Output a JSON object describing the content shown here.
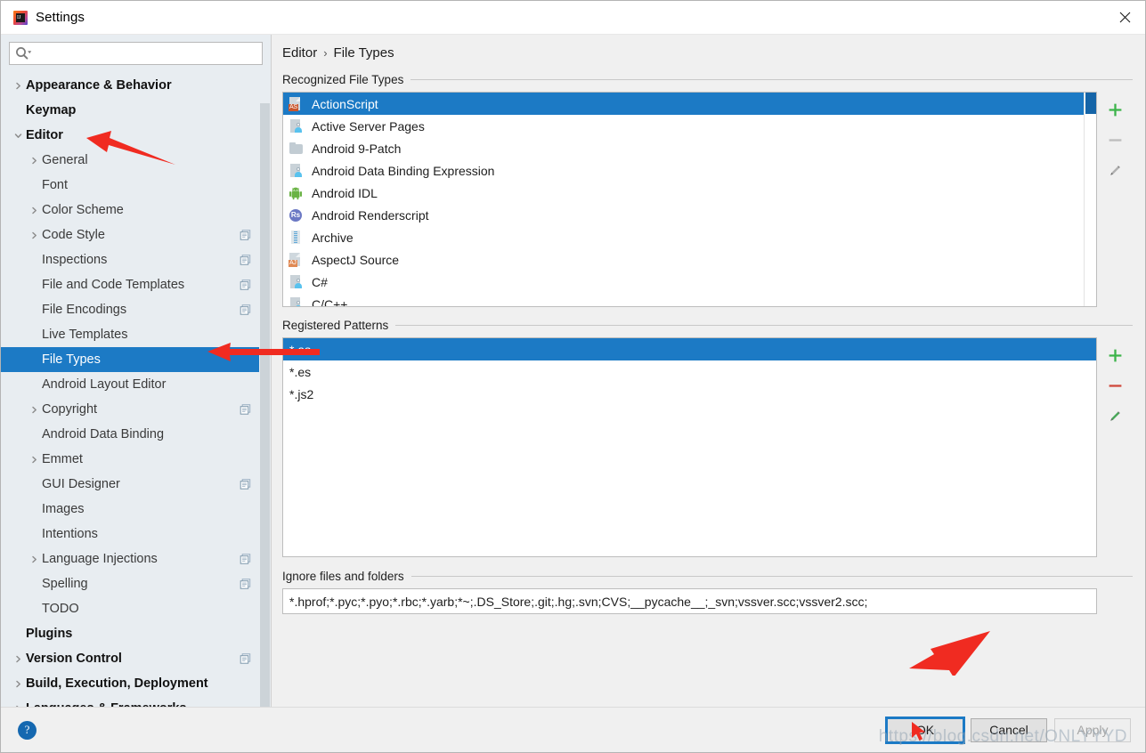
{
  "window": {
    "title": "Settings",
    "app_icon": "intellij-idea-icon",
    "close_label": "✕"
  },
  "search": {
    "value": "",
    "placeholder": "",
    "icon": "search-icon"
  },
  "sidebar": {
    "items": [
      {
        "label": "Appearance & Behavior",
        "level": 0,
        "style": "bold",
        "arrow": "chevron-right",
        "badge": false,
        "selected": false
      },
      {
        "label": "Keymap",
        "level": 0,
        "style": "bold",
        "arrow": "none",
        "badge": false,
        "selected": false
      },
      {
        "label": "Editor",
        "level": 0,
        "style": "bold",
        "arrow": "chevron-down",
        "badge": false,
        "selected": false
      },
      {
        "label": "General",
        "level": 1,
        "style": "sub",
        "arrow": "chevron-right",
        "badge": false,
        "selected": false
      },
      {
        "label": "Font",
        "level": 1,
        "style": "sub",
        "arrow": "none",
        "badge": false,
        "selected": false
      },
      {
        "label": "Color Scheme",
        "level": 1,
        "style": "sub",
        "arrow": "chevron-right",
        "badge": false,
        "selected": false
      },
      {
        "label": "Code Style",
        "level": 1,
        "style": "sub",
        "arrow": "chevron-right",
        "badge": true,
        "selected": false
      },
      {
        "label": "Inspections",
        "level": 1,
        "style": "sub",
        "arrow": "none",
        "badge": true,
        "selected": false
      },
      {
        "label": "File and Code Templates",
        "level": 1,
        "style": "sub",
        "arrow": "none",
        "badge": true,
        "selected": false
      },
      {
        "label": "File Encodings",
        "level": 1,
        "style": "sub",
        "arrow": "none",
        "badge": true,
        "selected": false
      },
      {
        "label": "Live Templates",
        "level": 1,
        "style": "sub",
        "arrow": "none",
        "badge": false,
        "selected": false
      },
      {
        "label": "File Types",
        "level": 1,
        "style": "sub",
        "arrow": "none",
        "badge": false,
        "selected": true
      },
      {
        "label": "Android Layout Editor",
        "level": 1,
        "style": "sub",
        "arrow": "none",
        "badge": false,
        "selected": false
      },
      {
        "label": "Copyright",
        "level": 1,
        "style": "sub",
        "arrow": "chevron-right",
        "badge": true,
        "selected": false
      },
      {
        "label": "Android Data Binding",
        "level": 1,
        "style": "sub",
        "arrow": "none",
        "badge": false,
        "selected": false
      },
      {
        "label": "Emmet",
        "level": 1,
        "style": "sub",
        "arrow": "chevron-right",
        "badge": false,
        "selected": false
      },
      {
        "label": "GUI Designer",
        "level": 1,
        "style": "sub",
        "arrow": "none",
        "badge": true,
        "selected": false
      },
      {
        "label": "Images",
        "level": 1,
        "style": "sub",
        "arrow": "none",
        "badge": false,
        "selected": false
      },
      {
        "label": "Intentions",
        "level": 1,
        "style": "sub",
        "arrow": "none",
        "badge": false,
        "selected": false
      },
      {
        "label": "Language Injections",
        "level": 1,
        "style": "sub",
        "arrow": "chevron-right",
        "badge": true,
        "selected": false
      },
      {
        "label": "Spelling",
        "level": 1,
        "style": "sub",
        "arrow": "none",
        "badge": true,
        "selected": false
      },
      {
        "label": "TODO",
        "level": 1,
        "style": "sub",
        "arrow": "none",
        "badge": false,
        "selected": false
      },
      {
        "label": "Plugins",
        "level": 0,
        "style": "bold",
        "arrow": "none",
        "badge": false,
        "selected": false
      },
      {
        "label": "Version Control",
        "level": 0,
        "style": "bold",
        "arrow": "chevron-right",
        "badge": true,
        "selected": false
      },
      {
        "label": "Build, Execution, Deployment",
        "level": 0,
        "style": "bold",
        "arrow": "chevron-right",
        "badge": false,
        "selected": false
      },
      {
        "label": "Languages & Frameworks",
        "level": 0,
        "style": "bold",
        "arrow": "chevron-right",
        "badge": false,
        "selected": false
      }
    ]
  },
  "breadcrumb": {
    "parent": "Editor",
    "separator": "›",
    "current": "File Types"
  },
  "recognized": {
    "title": "Recognized File Types",
    "rows": [
      {
        "label": "ActionScript",
        "icon": "actionscript-file-icon",
        "icon_kind": "doc",
        "tag": "AS",
        "tag_color": "#c9572e",
        "selected": true
      },
      {
        "label": "Active Server Pages",
        "icon": "asp-file-icon",
        "icon_kind": "person",
        "selected": false
      },
      {
        "label": "Android 9-Patch",
        "icon": "folder-icon",
        "icon_kind": "folder",
        "selected": false
      },
      {
        "label": "Android Data Binding Expression",
        "icon": "databinding-file-icon",
        "icon_kind": "person",
        "selected": false
      },
      {
        "label": "Android IDL",
        "icon": "android-robot-icon",
        "icon_kind": "android",
        "selected": false
      },
      {
        "label": "Android Renderscript",
        "icon": "renderscript-icon",
        "icon_kind": "rs",
        "tag": "Rs",
        "selected": false
      },
      {
        "label": "Archive",
        "icon": "archive-zip-icon",
        "icon_kind": "zip",
        "selected": false
      },
      {
        "label": "AspectJ Source",
        "icon": "aspectj-file-icon",
        "icon_kind": "doc",
        "tag": "AJ",
        "tag_color": "#e08a55",
        "selected": false
      },
      {
        "label": "C#",
        "icon": "csharp-file-icon",
        "icon_kind": "person",
        "selected": false
      },
      {
        "label": "C/C++",
        "icon": "cpp-file-icon",
        "icon_kind": "person",
        "selected": false
      }
    ],
    "toolbar": [
      {
        "name": "add-file-type-button",
        "icon": "plus-icon",
        "color": "#3cb44a",
        "enabled": true
      },
      {
        "name": "remove-file-type-button",
        "icon": "minus-icon",
        "color": "#bdbdbd",
        "enabled": false
      },
      {
        "name": "edit-file-type-button",
        "icon": "pencil-icon",
        "color": "#b0b0b0",
        "enabled": false
      }
    ]
  },
  "patterns": {
    "title": "Registered Patterns",
    "rows": [
      {
        "label": "*.as",
        "selected": true
      },
      {
        "label": "*.es",
        "selected": false
      },
      {
        "label": "*.js2",
        "selected": false
      }
    ],
    "toolbar": [
      {
        "name": "add-pattern-button",
        "icon": "plus-icon",
        "color": "#3cb44a",
        "enabled": true
      },
      {
        "name": "remove-pattern-button",
        "icon": "minus-icon",
        "color": "#d0493c",
        "enabled": true
      },
      {
        "name": "edit-pattern-button",
        "icon": "pencil-icon",
        "color": "#4aa85a",
        "enabled": true
      }
    ]
  },
  "ignore": {
    "title": "Ignore files and folders",
    "value": "*.hprof;*.pyc;*.pyo;*.rbc;*.yarb;*~;.DS_Store;.git;.hg;.svn;CVS;__pycache__;_svn;vssver.scc;vssver2.scc;",
    "placeholder": ""
  },
  "footer": {
    "help_label": "?",
    "ok_label": "OK",
    "cancel_label": "Cancel",
    "apply_label": "Apply"
  },
  "watermark": {
    "text": "https://blog.csdn.net/ONLYYYD"
  },
  "colors": {
    "selection_blue": "#1c7ac5",
    "sidebar_bg": "#e8edf1",
    "panel_bg": "#f0f0f0",
    "annotation_red": "#f02b21",
    "scrollbar_thumb": "#ccd3d8"
  }
}
